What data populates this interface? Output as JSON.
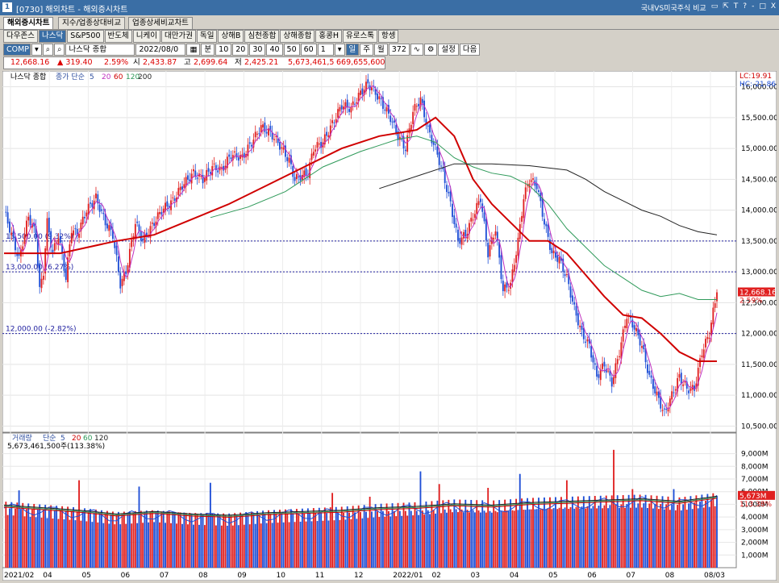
{
  "window": {
    "badge": "1",
    "title": "[0730] 해외차트 - 해외증시차트",
    "right_label": "국내VS미국주식 비교",
    "controls": [
      "▭",
      "⇱",
      "T",
      "?",
      "-",
      "□",
      "X"
    ]
  },
  "tabs": [
    "해외증시차트",
    "지수/업종상대비교",
    "업종상세비교차트"
  ],
  "markets": [
    "다우존스",
    "나스닥",
    "S&P500",
    "반도체",
    "니케이",
    "대만가권",
    "독일",
    "상해B",
    "심천종합",
    "상해종합",
    "홍콩H",
    "유로스톡",
    "항셍"
  ],
  "active_market": 1,
  "toolbar": {
    "symbol": "COMP",
    "symbol_name": "나스닥 종합",
    "date": "2022/08/0",
    "period_buttons": [
      "분",
      "10",
      "20",
      "30",
      "40",
      "50",
      "60"
    ],
    "period_value": "1",
    "day": "일",
    "week": "주",
    "month": "월",
    "count": "372",
    "settings": "설정",
    "next": "다음"
  },
  "quote": {
    "price": "12,668.16",
    "change": "▲ 319.40",
    "change_pct": "2.59%",
    "open_label": "시",
    "open": "2,433.87",
    "high_label": "고",
    "high": "2,699.64",
    "low_label": "저",
    "low": "2,425.21",
    "volume": "5,673,461,5",
    "amount": "669,655,600"
  },
  "colors": {
    "up": "#e02020",
    "down": "#1f4fd6",
    "ma5": "#c030c0",
    "ma20": "#d00000",
    "ma60": "#2f9a5a",
    "ma120": "#222222",
    "hline": "#2020a0"
  },
  "chart_data": {
    "type": "line",
    "price_legend": {
      "name": "나스닥 종합",
      "ma_label": "종가 단순",
      "periods": [
        "5",
        "20",
        "60",
        "120",
        "200"
      ]
    },
    "corner_labels": {
      "lc": "LC:19.91",
      "hc": "HC:-21.86"
    },
    "price_axis": {
      "ticks": [
        "16,000.00",
        "15,500.00",
        "15,000.00",
        "14,500.00",
        "14,000.00",
        "13,500.00",
        "13,000.00",
        "12,500.00",
        "12,000.00",
        "11,500.00",
        "11,000.00",
        "10,500.00"
      ],
      "ylim": [
        10400,
        16230
      ]
    },
    "price_tag": {
      "value": "12,668.16",
      "pct": "2.59%"
    },
    "hlines": [
      {
        "value": 13500,
        "label": "13,500.00 (9.32%)"
      },
      {
        "value": 13000,
        "label": "13,000.00 (6.27%)"
      },
      {
        "value": 12000,
        "label": "12,000.00 (-2.82%)"
      }
    ],
    "x_labels": [
      "2021/02",
      "04",
      "05",
      "06",
      "07",
      "08",
      "09",
      "10",
      "11",
      "12",
      "2022/01",
      "02",
      "03",
      "04",
      "05",
      "06",
      "07",
      "08",
      "08/03"
    ],
    "price_path": [
      [
        0,
        14000
      ],
      [
        8,
        13200
      ],
      [
        13,
        13900
      ],
      [
        17,
        13600
      ],
      [
        19,
        12700
      ],
      [
        21,
        13000
      ],
      [
        23,
        13800
      ],
      [
        26,
        13300
      ],
      [
        29,
        13600
      ],
      [
        33,
        12900
      ],
      [
        36,
        13700
      ],
      [
        39,
        13600
      ],
      [
        44,
        14000
      ],
      [
        49,
        14200
      ],
      [
        54,
        13800
      ],
      [
        58,
        13600
      ],
      [
        62,
        12800
      ],
      [
        65,
        13000
      ],
      [
        70,
        13800
      ],
      [
        74,
        13500
      ],
      [
        78,
        13700
      ],
      [
        84,
        14000
      ],
      [
        90,
        14150
      ],
      [
        95,
        14400
      ],
      [
        101,
        14600
      ],
      [
        106,
        14500
      ],
      [
        111,
        14700
      ],
      [
        116,
        14650
      ],
      [
        121,
        14900
      ],
      [
        127,
        14850
      ],
      [
        132,
        15100
      ],
      [
        137,
        15350
      ],
      [
        142,
        15250
      ],
      [
        147,
        15050
      ],
      [
        152,
        14800
      ],
      [
        155,
        14500
      ],
      [
        158,
        14550
      ],
      [
        162,
        14600
      ],
      [
        165,
        15000
      ],
      [
        170,
        15100
      ],
      [
        175,
        15400
      ],
      [
        180,
        15700
      ],
      [
        185,
        15650
      ],
      [
        190,
        15900
      ],
      [
        194,
        16050
      ],
      [
        198,
        15900
      ],
      [
        202,
        15700
      ],
      [
        206,
        15500
      ],
      [
        210,
        15200
      ],
      [
        214,
        15000
      ],
      [
        218,
        15600
      ],
      [
        222,
        15800
      ],
      [
        226,
        15300
      ],
      [
        230,
        15000
      ],
      [
        234,
        14600
      ],
      [
        238,
        14100
      ],
      [
        242,
        13500
      ],
      [
        246,
        13600
      ],
      [
        250,
        13900
      ],
      [
        254,
        14200
      ],
      [
        258,
        13300
      ],
      [
        262,
        13700
      ],
      [
        266,
        12700
      ],
      [
        270,
        12800
      ],
      [
        274,
        13500
      ],
      [
        277,
        14200
      ],
      [
        280,
        14500
      ],
      [
        284,
        14400
      ],
      [
        288,
        13800
      ],
      [
        292,
        13300
      ],
      [
        296,
        13200
      ],
      [
        300,
        12900
      ],
      [
        304,
        12400
      ],
      [
        308,
        12000
      ],
      [
        312,
        11800
      ],
      [
        316,
        11300
      ],
      [
        320,
        11500
      ],
      [
        324,
        11200
      ],
      [
        328,
        11700
      ],
      [
        332,
        12300
      ],
      [
        336,
        12100
      ],
      [
        340,
        11800
      ],
      [
        344,
        11300
      ],
      [
        348,
        11000
      ],
      [
        352,
        10700
      ],
      [
        356,
        11000
      ],
      [
        360,
        11300
      ],
      [
        364,
        11100
      ],
      [
        368,
        11100
      ],
      [
        372,
        11700
      ],
      [
        376,
        12000
      ],
      [
        378,
        12350
      ],
      [
        380,
        12668
      ]
    ],
    "price_high": 16212,
    "price_low": 10565,
    "ma_series": [
      {
        "name": "20",
        "points": [
          [
            0,
            13300
          ],
          [
            30,
            13300
          ],
          [
            60,
            13500
          ],
          [
            80,
            13600
          ],
          [
            100,
            13850
          ],
          [
            120,
            14100
          ],
          [
            140,
            14400
          ],
          [
            160,
            14700
          ],
          [
            180,
            15000
          ],
          [
            200,
            15200
          ],
          [
            220,
            15300
          ],
          [
            230,
            15500
          ],
          [
            240,
            15200
          ],
          [
            250,
            14500
          ],
          [
            260,
            14100
          ],
          [
            270,
            13800
          ],
          [
            280,
            13500
          ],
          [
            290,
            13500
          ],
          [
            300,
            13300
          ],
          [
            310,
            12950
          ],
          [
            320,
            12600
          ],
          [
            330,
            12300
          ],
          [
            340,
            12250
          ],
          [
            350,
            12000
          ],
          [
            360,
            11700
          ],
          [
            370,
            11550
          ],
          [
            380,
            11550
          ]
        ]
      },
      {
        "name": "60",
        "points": [
          [
            110,
            13880
          ],
          [
            130,
            14050
          ],
          [
            150,
            14300
          ],
          [
            170,
            14700
          ],
          [
            190,
            14950
          ],
          [
            200,
            15050
          ],
          [
            210,
            15150
          ],
          [
            220,
            15200
          ],
          [
            230,
            15100
          ],
          [
            240,
            14850
          ],
          [
            250,
            14700
          ],
          [
            260,
            14600
          ],
          [
            270,
            14550
          ],
          [
            280,
            14400
          ],
          [
            290,
            14100
          ],
          [
            300,
            13700
          ],
          [
            310,
            13400
          ],
          [
            320,
            13100
          ],
          [
            330,
            12900
          ],
          [
            340,
            12700
          ],
          [
            350,
            12600
          ],
          [
            360,
            12650
          ],
          [
            370,
            12550
          ],
          [
            380,
            12550
          ]
        ]
      },
      {
        "name": "120",
        "points": [
          [
            200,
            14350
          ],
          [
            220,
            14550
          ],
          [
            240,
            14750
          ],
          [
            260,
            14750
          ],
          [
            280,
            14720
          ],
          [
            300,
            14650
          ],
          [
            310,
            14500
          ],
          [
            320,
            14300
          ],
          [
            330,
            14150
          ],
          [
            340,
            14000
          ],
          [
            350,
            13900
          ],
          [
            360,
            13750
          ],
          [
            370,
            13650
          ],
          [
            380,
            13600
          ]
        ]
      }
    ],
    "volume_legend": {
      "name": "거래량",
      "ma_label": "단순",
      "periods": [
        "5",
        "20",
        "60",
        "120"
      ],
      "value": "5,673,461,500주(113.38%)"
    },
    "volume_axis": {
      "ticks": [
        "9,000M",
        "8,000M",
        "7,000M",
        "6,000M",
        "5,000M",
        "4,000M",
        "3,000M",
        "2,000M",
        "1,000M"
      ],
      "ylim": [
        0,
        9800
      ]
    },
    "volume_tag": {
      "value": "5,673M",
      "pct": "113.38%"
    },
    "volume_profile": [
      [
        0,
        4700
      ],
      [
        20,
        4500
      ],
      [
        40,
        4300
      ],
      [
        60,
        4000
      ],
      [
        80,
        4200
      ],
      [
        100,
        4000
      ],
      [
        120,
        3900
      ],
      [
        140,
        4100
      ],
      [
        160,
        4200
      ],
      [
        180,
        4300
      ],
      [
        200,
        4500
      ],
      [
        220,
        4600
      ],
      [
        240,
        4800
      ],
      [
        260,
        4700
      ],
      [
        280,
        4900
      ],
      [
        300,
        5000
      ],
      [
        320,
        5100
      ],
      [
        340,
        5200
      ],
      [
        360,
        5000
      ],
      [
        380,
        5400
      ]
    ],
    "volume_spikes": [
      [
        8,
        6100
      ],
      [
        40,
        6900
      ],
      [
        72,
        6400
      ],
      [
        110,
        6700
      ],
      [
        175,
        5900
      ],
      [
        195,
        5600
      ],
      [
        222,
        7600
      ],
      [
        232,
        6600
      ],
      [
        258,
        6300
      ],
      [
        275,
        7400
      ],
      [
        300,
        6900
      ],
      [
        325,
        9300
      ],
      [
        335,
        6200
      ],
      [
        357,
        6200
      ],
      [
        380,
        5673
      ]
    ]
  }
}
